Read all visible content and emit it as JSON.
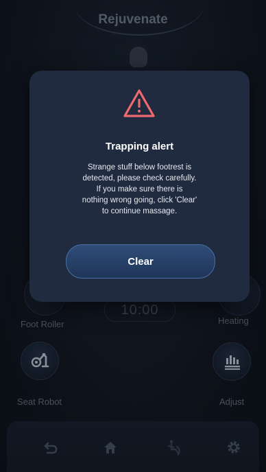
{
  "header": {
    "title": "Rejuvenate"
  },
  "controls": {
    "foot_roller": "Foot Roller",
    "heating": "Heating",
    "seat_robot": "Seat Robot",
    "adjust": "Adjust"
  },
  "timer": {
    "value": "10:00"
  },
  "bottom_nav": {
    "icons": [
      "back-arrow-icon",
      "home-icon",
      "massage-mode-icon",
      "settings-gear-icon"
    ]
  },
  "dialog": {
    "title": "Trapping alert",
    "lines": [
      "Strange stuff below footrest is",
      "detected, please check carefully.",
      "If you make sure there is",
      "nothing wrong going, click 'Clear'",
      "to continue massage."
    ],
    "button_label": "Clear",
    "icon": "warning-triangle-icon"
  },
  "colors": {
    "background": "#141a24",
    "dialog_bg": "#202b40",
    "warning": "#f06a6e",
    "button_border": "#4a6fa3"
  }
}
